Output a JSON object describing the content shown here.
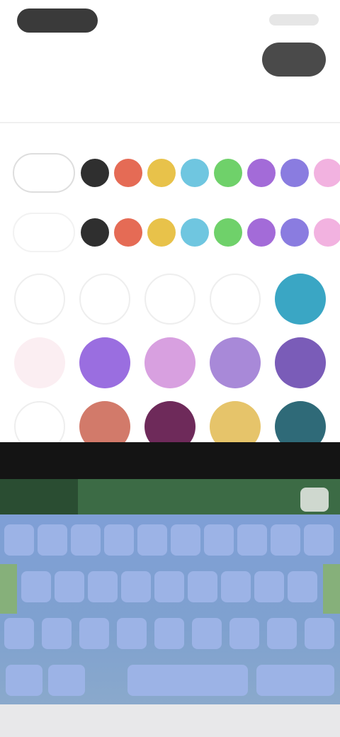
{
  "header": {
    "title": "",
    "done_label": "",
    "section_label": ""
  },
  "colors": {
    "row_a": [
      "#2f2f2f",
      "#e56b55",
      "#e8c24a",
      "#6fc6e0",
      "#6fd16a",
      "#a36bd8",
      "#8a7ce0",
      "#f2b2e0"
    ],
    "row_b": [
      "#2f2f2f",
      "#e56b55",
      "#e8c24a",
      "#6fc6e0",
      "#6fd16a",
      "#a36bd8",
      "#8a7ce0",
      "#f2b2e0"
    ]
  },
  "themes": {
    "row1": [
      "",
      "",
      "",
      "",
      "#3aa6c4"
    ],
    "row2": [
      "#fbeef2",
      "#9a6ee0",
      "#d8a0e0",
      "#a889d8",
      "#7a5cb8"
    ],
    "row3": [
      "",
      "#d27a6a",
      "#6e2a5a",
      "#e6c46a",
      "#2f6a78"
    ]
  },
  "keyboard": {
    "row1": [
      "",
      "",
      "",
      "",
      "",
      "",
      "",
      "",
      "",
      ""
    ],
    "row2": [
      "",
      "",
      "",
      "",
      "",
      "",
      "",
      "",
      ""
    ],
    "row3": [
      "",
      "",
      "",
      "",
      "",
      "",
      "",
      "",
      ""
    ],
    "row4": [
      "",
      "",
      "",
      ""
    ]
  }
}
